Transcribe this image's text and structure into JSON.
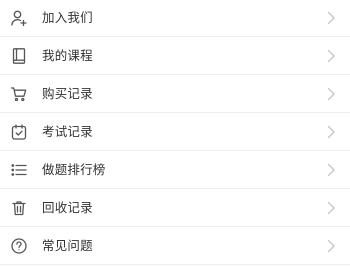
{
  "menu": {
    "items": [
      {
        "label": "加入我们",
        "icon": "person-add-icon"
      },
      {
        "label": "我的课程",
        "icon": "book-icon"
      },
      {
        "label": "购买记录",
        "icon": "cart-icon"
      },
      {
        "label": "考试记录",
        "icon": "calendar-check-icon"
      },
      {
        "label": "做题排行榜",
        "icon": "list-icon"
      },
      {
        "label": "回收记录",
        "icon": "trash-icon"
      },
      {
        "label": "常见问题",
        "icon": "help-circle-icon"
      }
    ]
  },
  "colors": {
    "icon": "#555555",
    "text": "#333333",
    "chevron": "#c6c6c6",
    "divider": "#efefef"
  }
}
